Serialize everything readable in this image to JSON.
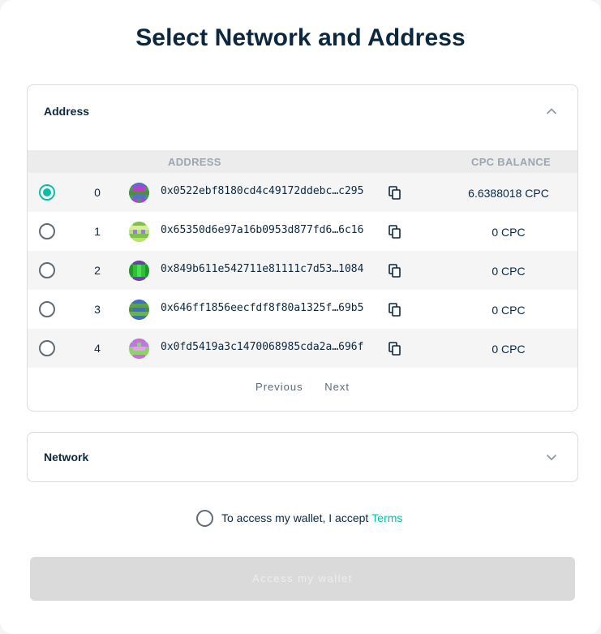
{
  "title": "Select Network and Address",
  "address_panel": {
    "title": "Address",
    "columns": {
      "address": "ADDRESS",
      "balance": "CPC BALANCE"
    },
    "rows": [
      {
        "index": "0",
        "address": "0x0522ebf8180cd4c49172ddebc…c295",
        "balance": "6.6388018 CPC",
        "selected": true
      },
      {
        "index": "1",
        "address": "0x65350d6e97a16b0953d877fd6…6c16",
        "balance": "0 CPC",
        "selected": false
      },
      {
        "index": "2",
        "address": "0x849b611e542711e81111c7d53…1084",
        "balance": "0 CPC",
        "selected": false
      },
      {
        "index": "3",
        "address": "0x646ff1856eecfdf8f80a1325f…69b5",
        "balance": "0 CPC",
        "selected": false
      },
      {
        "index": "4",
        "address": "0x0fd5419a3c1470068985cda2a…696f",
        "balance": "0 CPC",
        "selected": false
      }
    ],
    "pagination": {
      "previous": "Previous",
      "next": "Next"
    }
  },
  "network_panel": {
    "title": "Network"
  },
  "terms": {
    "text": "To access my wallet, I accept",
    "link": "Terms"
  },
  "access_button": "Access my wallet",
  "colors": {
    "accent": "#05c0a5",
    "title": "#0b2840",
    "disabled_button": "#dadada"
  },
  "icons": {
    "collapse": "chevron-up-icon",
    "expand": "chevron-down-icon",
    "copy": "copy-icon"
  }
}
